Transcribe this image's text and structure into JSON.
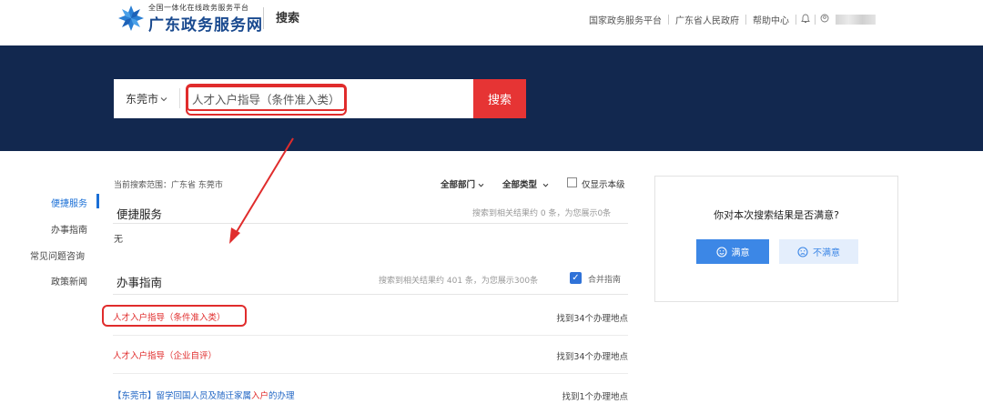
{
  "header": {
    "site_subtitle": "全国一体化在线政务服务平台",
    "site_name": "广东政务服务网",
    "page_title": "搜索",
    "nav": [
      "国家政务服务平台",
      "广东省人民政府",
      "帮助中心"
    ],
    "bell_icon": "bell-icon",
    "user_icon": "user-icon"
  },
  "search": {
    "city": "东莞市",
    "query": "人才入户指导（条件准入类）",
    "button": "搜索"
  },
  "sidebar": {
    "items": [
      {
        "label": "便捷服务",
        "active": true
      },
      {
        "label": "办事指南",
        "active": false
      },
      {
        "label": "常见问题咨询",
        "active": false
      },
      {
        "label": "政策新闻",
        "active": false
      }
    ]
  },
  "scope": "当前搜索范围：广东省 东莞市",
  "filters": {
    "department": "全部部门",
    "type": "全部类型",
    "only_this_level": "仅显示本级"
  },
  "quick_service": {
    "title": "便捷服务",
    "meta": "搜索到相关结果约 0 条，为您展示0条",
    "empty": "无"
  },
  "guide": {
    "title": "办事指南",
    "meta": "搜索到相关结果约 401 条，为您展示300条",
    "merge_label": "合并指南",
    "results": [
      {
        "title": "人才入户指导（条件准入类）",
        "locations": "找到34个办理地点"
      },
      {
        "title": "人才入户指导（企业自评）",
        "locations": "找到34个办理地点"
      },
      {
        "title_prefix": "【东莞市】留学回国人员及随迁家属",
        "title_highlight": "入户",
        "title_suffix": "的办理",
        "locations": "找到1个办理地点"
      }
    ]
  },
  "survey": {
    "question": "你对本次搜索结果是否满意?",
    "satisfied": "满意",
    "unsatisfied": "不满意"
  },
  "colors": {
    "banner": "#12284f",
    "accent_red": "#e02c2c",
    "accent_blue": "#3c87e6",
    "brand_blue": "#1a4a8f"
  }
}
